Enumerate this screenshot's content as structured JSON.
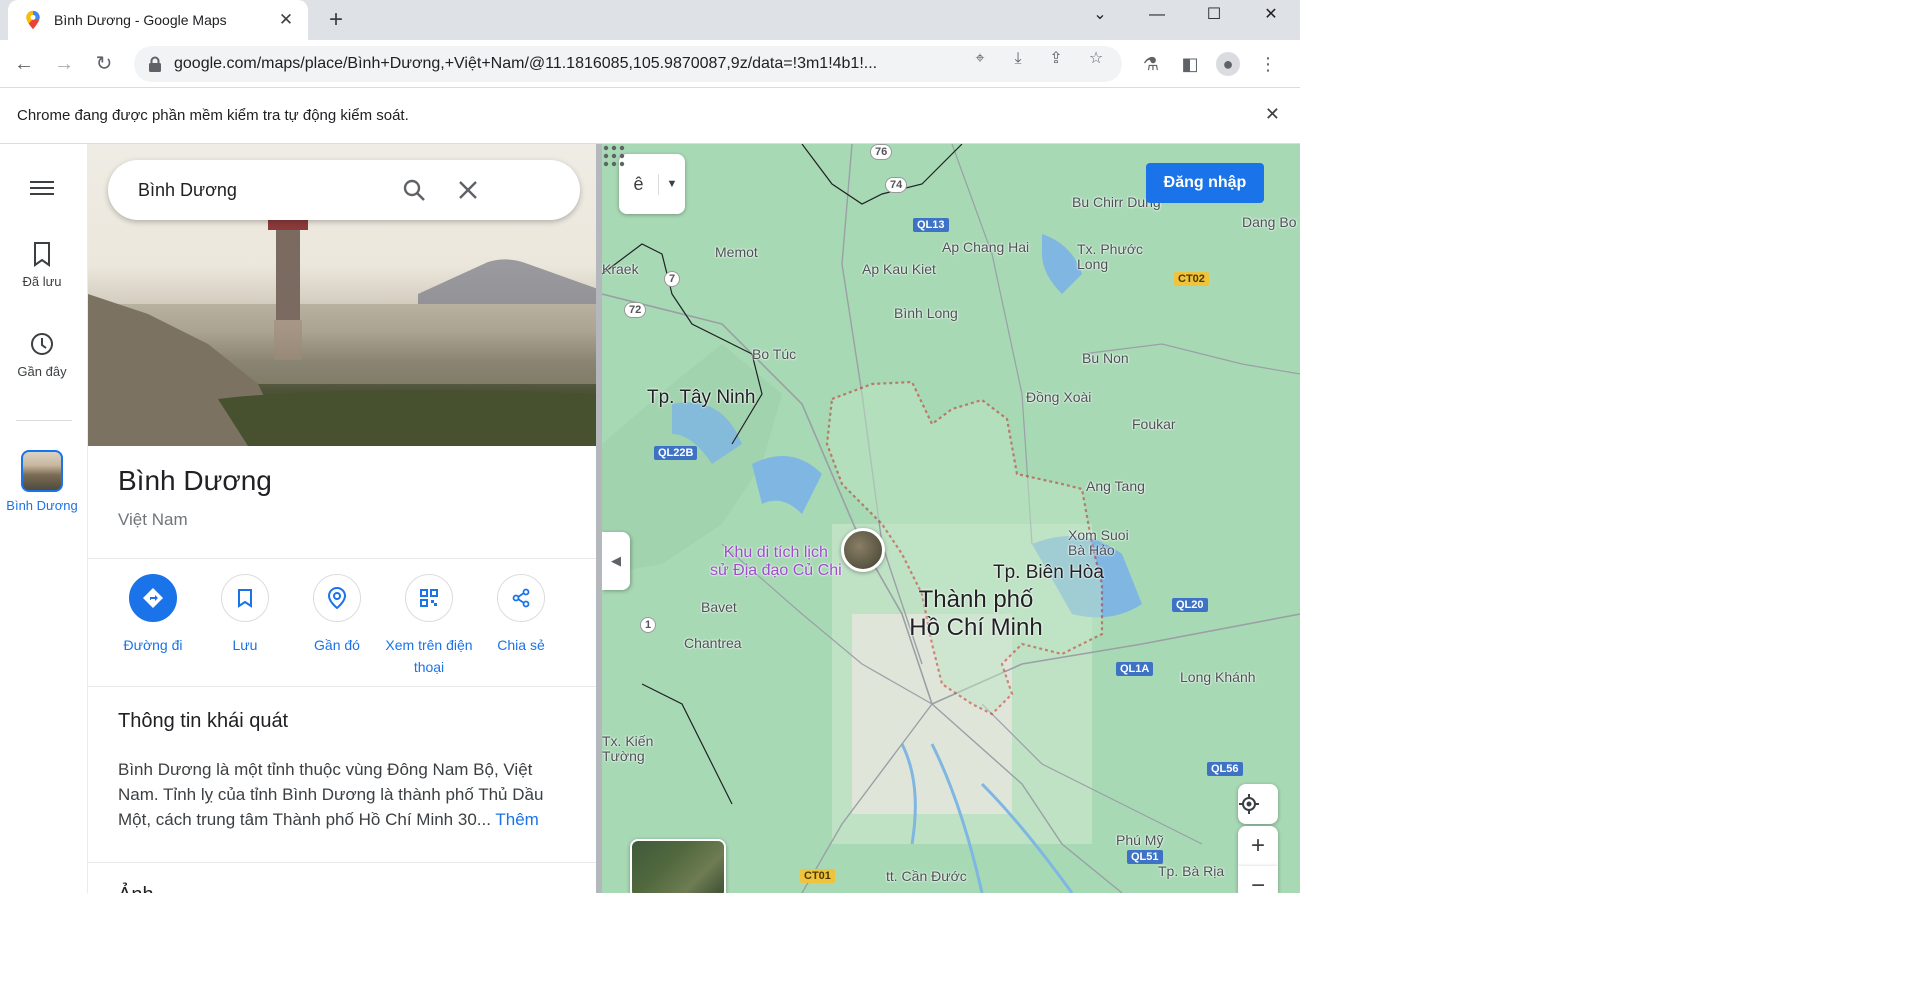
{
  "browser": {
    "tab_title": "Bình Dương - Google Maps",
    "url": "google.com/maps/place/Bình+Dương,+Việt+Nam/@11.1816085,105.9870087,9z/data=!3m1!4b1!...",
    "infobar_message": "Chrome đang được phần mềm kiểm tra tự động kiểm soát."
  },
  "rail": {
    "saved_label": "Đã lưu",
    "recent_label": "Gần đây",
    "place_label": "Bình Dương"
  },
  "search": {
    "value": "Bình Dương"
  },
  "place": {
    "title": "Bình Dương",
    "subtitle": "Việt Nam",
    "actions": [
      {
        "label": "Đường đi"
      },
      {
        "label": "Lưu"
      },
      {
        "label": "Gần đó"
      },
      {
        "label": "Xem trên điện thoại"
      },
      {
        "label": "Chia sẻ"
      }
    ],
    "about_heading": "Thông tin khái quát",
    "about_text": "Bình Dương là một tỉnh thuộc vùng Đông Nam Bộ, Việt Nam. Tỉnh lỵ của tỉnh Bình Dương là thành phố Thủ Dầu Một, cách trung tâm Thành phố Hồ Chí Minh 30...",
    "about_more": "Thêm",
    "next_heading": "Ảnh"
  },
  "map": {
    "signin_label": "Đăng nhập",
    "layer_label": "ê",
    "labels": {
      "tay_ninh": "Tp. Tây Ninh",
      "bien_hoa": "Tp. Biên Hòa",
      "hcm_line1": "Thành phố",
      "hcm_line2": "Hồ Chí Minh",
      "poi_line1": "Khu di tích lịch",
      "poi_line2": "sử Địa đạo Củ Chi",
      "memot": "Memot",
      "kraek": "Kraek",
      "ap_kau_kiet": "Ap Kau Kiet",
      "ap_chang_hai": "Ap Chang Hai",
      "bu_chirr_dung": "Bu Chirr Dung",
      "dang_bo": "Dang Bo",
      "tx_phuoc_long": "Tx. Phước Long",
      "binh_long": "Bình Long",
      "bo_tuc": "Bo Túc",
      "bu_non": "Bu Non",
      "dong_xoai": "Đồng Xoài",
      "foukar": "Foukar",
      "ang_tang": "Ang Tang",
      "xom_suoi_ba_hao": "Xom Suoi Bà Hảo",
      "bavet": "Bavet",
      "chantrea": "Chantrea",
      "long_khanh": "Long Khánh",
      "tx_kien_tuong": "Tx. Kiến Tường",
      "phu_my": "Phú Mỹ",
      "can_duoc": "tt. Cần Đước",
      "ba_ria": "Tp. Bà Rịa"
    },
    "shields": {
      "ql13": "QL13",
      "ql22b": "QL22B",
      "ct02": "CT02",
      "ql20": "QL20",
      "ql1a": "QL1A",
      "ql56": "QL56",
      "ql51": "QL51",
      "ct01": "CT01",
      "r74": "74",
      "r7": "7",
      "r72": "72",
      "r1": "1",
      "r76": "76"
    }
  },
  "colors": {
    "accent": "#1a73e8",
    "map_land": "#a8d9b5",
    "boundary": "#c5221f"
  }
}
